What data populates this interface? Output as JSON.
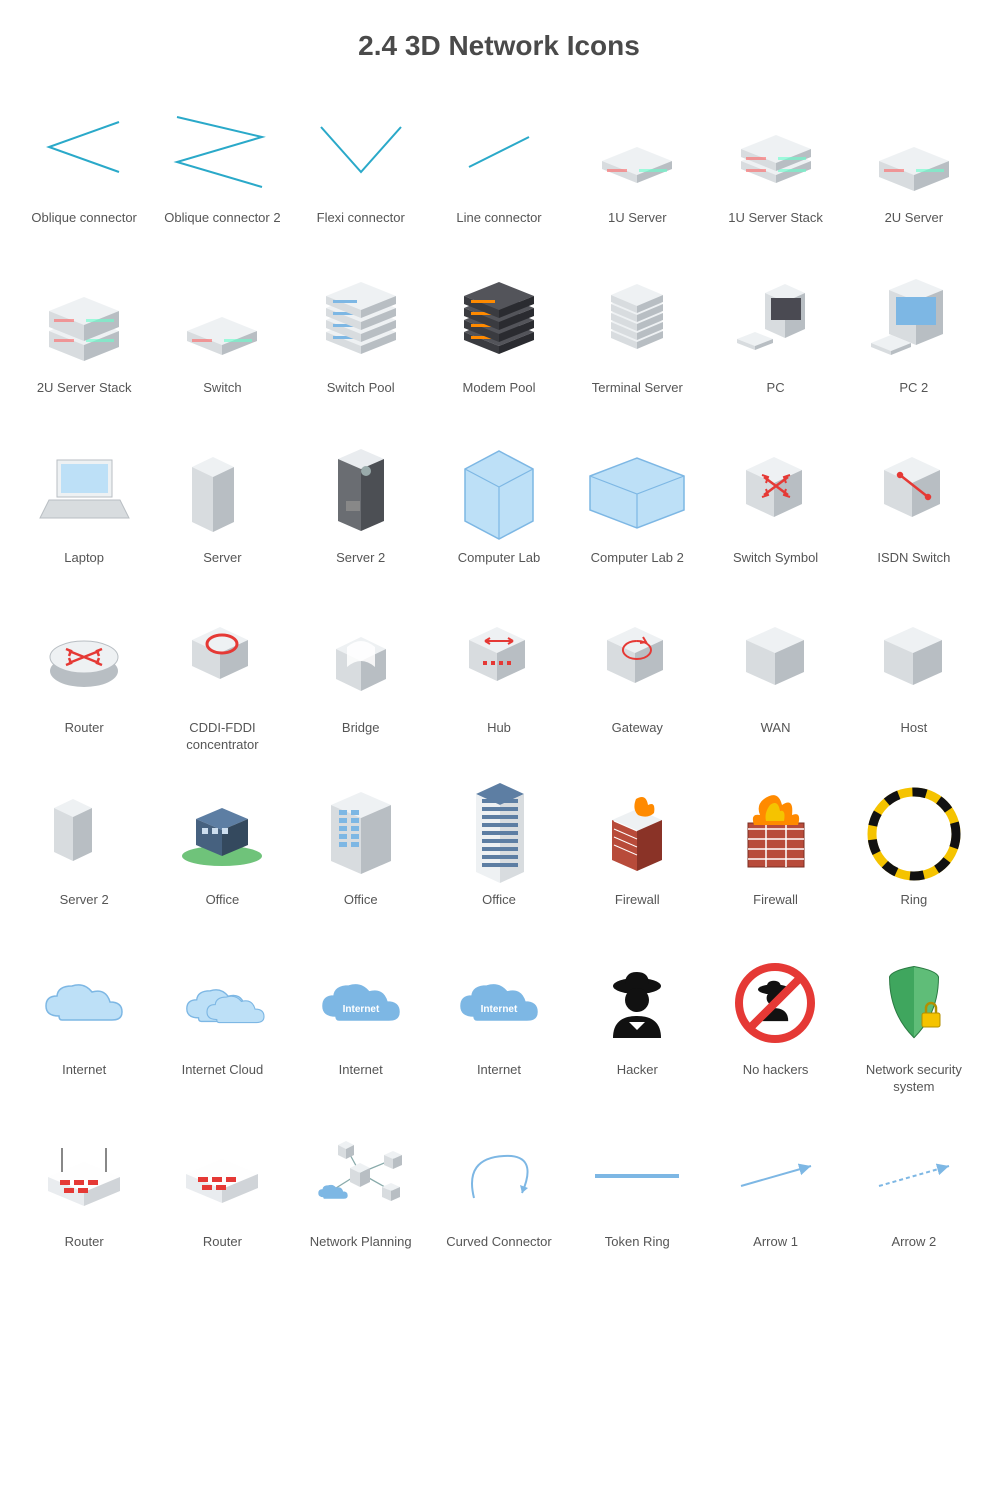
{
  "title": "2.4 3D Network Icons",
  "icons": [
    {
      "label": "Oblique connector",
      "id": "oblique-connector"
    },
    {
      "label": "Oblique connector 2",
      "id": "oblique-connector-2"
    },
    {
      "label": "Flexi connector",
      "id": "flexi-connector"
    },
    {
      "label": "Line connector",
      "id": "line-connector"
    },
    {
      "label": "1U Server",
      "id": "1u-server"
    },
    {
      "label": "1U Server Stack",
      "id": "1u-server-stack"
    },
    {
      "label": "2U Server",
      "id": "2u-server"
    },
    {
      "label": "2U Server Stack",
      "id": "2u-server-stack"
    },
    {
      "label": "Switch",
      "id": "switch"
    },
    {
      "label": "Switch Pool",
      "id": "switch-pool"
    },
    {
      "label": "Modem Pool",
      "id": "modem-pool"
    },
    {
      "label": "Terminal Server",
      "id": "terminal-server"
    },
    {
      "label": "PC",
      "id": "pc"
    },
    {
      "label": "PC 2",
      "id": "pc-2"
    },
    {
      "label": "Laptop",
      "id": "laptop"
    },
    {
      "label": "Server",
      "id": "server"
    },
    {
      "label": "Server 2",
      "id": "server-2"
    },
    {
      "label": "Computer Lab",
      "id": "computer-lab"
    },
    {
      "label": "Computer Lab 2",
      "id": "computer-lab-2"
    },
    {
      "label": "Switch Symbol",
      "id": "switch-symbol"
    },
    {
      "label": "ISDN Switch",
      "id": "isdn-switch"
    },
    {
      "label": "Router",
      "id": "router"
    },
    {
      "label": "CDDI-FDDI concentrator",
      "id": "cddi-fddi-concentrator"
    },
    {
      "label": "Bridge",
      "id": "bridge"
    },
    {
      "label": "Hub",
      "id": "hub"
    },
    {
      "label": "Gateway",
      "id": "gateway"
    },
    {
      "label": "WAN",
      "id": "wan"
    },
    {
      "label": "Host",
      "id": "host"
    },
    {
      "label": "Server 2",
      "id": "server-2b"
    },
    {
      "label": "Office",
      "id": "office-1"
    },
    {
      "label": "Office",
      "id": "office-2"
    },
    {
      "label": "Office",
      "id": "office-3"
    },
    {
      "label": "Firewall",
      "id": "firewall-1"
    },
    {
      "label": "Firewall",
      "id": "firewall-2"
    },
    {
      "label": "Ring",
      "id": "ring"
    },
    {
      "label": "Internet",
      "id": "internet-1"
    },
    {
      "label": "Internet Cloud",
      "id": "internet-cloud"
    },
    {
      "label": "Internet",
      "id": "internet-2"
    },
    {
      "label": "Internet",
      "id": "internet-3"
    },
    {
      "label": "Hacker",
      "id": "hacker"
    },
    {
      "label": "No hackers",
      "id": "no-hackers"
    },
    {
      "label": "Network security system",
      "id": "network-security"
    },
    {
      "label": "Router",
      "id": "router-2"
    },
    {
      "label": "Router",
      "id": "router-3"
    },
    {
      "label": "Network Planning",
      "id": "network-planning"
    },
    {
      "label": "Curved Connector",
      "id": "curved-connector"
    },
    {
      "label": "Token Ring",
      "id": "token-ring"
    },
    {
      "label": "Arrow 1",
      "id": "arrow-1"
    },
    {
      "label": "Arrow 2",
      "id": "arrow-2"
    }
  ],
  "colors": {
    "teal": "#2aa9c9",
    "grey": "#d8dcdf",
    "greyDark": "#b8bec3",
    "greyLight": "#eef1f3",
    "blueLight": "#bde0f7",
    "blueMed": "#7db7e4",
    "red": "#e53935",
    "maroon": "#a02924",
    "orange": "#ff8a00",
    "yellow": "#f5c300",
    "green": "#3fa65e",
    "black": "#111"
  }
}
